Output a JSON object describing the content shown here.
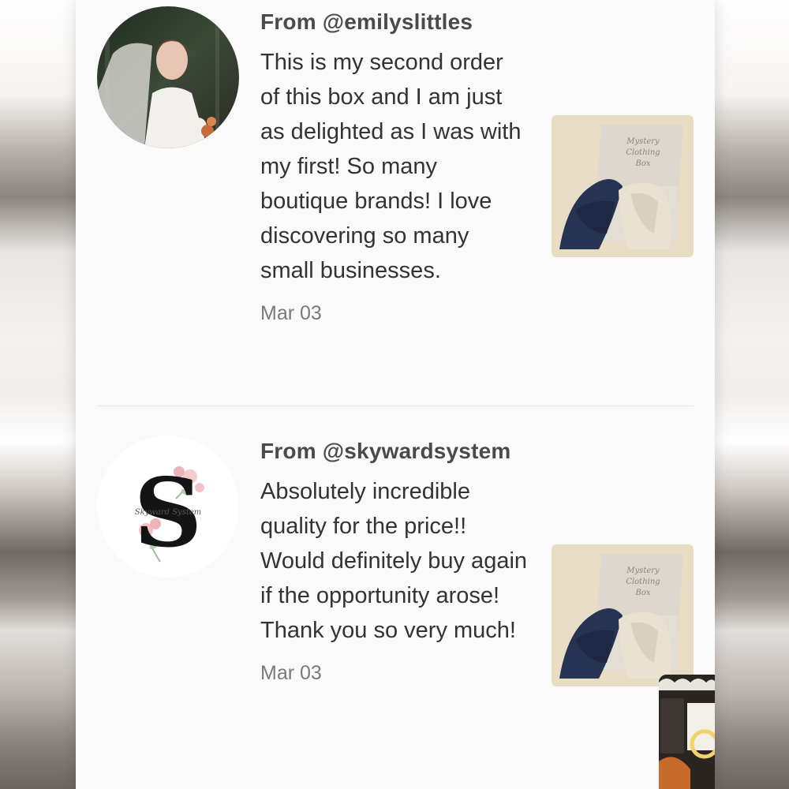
{
  "reviews": [
    {
      "author": "From @emilyslittles",
      "body": "This is my second order of this box and I am just as delighted as I was with my first! So many boutique brands! I love discovering so many small businesses.",
      "date": "Mar 03",
      "avatar_icon": "bride-photo",
      "thumb_icon": "mystery-box-photo",
      "thumb_box_text": "Mystery Clothing Box"
    },
    {
      "author": "From @skywardsystem",
      "body": "Absolutely incredible quality for the price!! Would definitely buy again if the opportunity arose! Thank you so very much!",
      "date": "Mar 03",
      "avatar_icon": "floral-s-monogram",
      "avatar_text": "Skyward System",
      "thumb_icon": "mystery-box-photo",
      "thumb_box_text": "Mystery Clothing Box"
    }
  ],
  "colors": {
    "panel": "#fafafa",
    "author": "#4a4a4a",
    "body": "#333333",
    "date": "#7a7a7a",
    "divider": "#e6e6e6"
  }
}
